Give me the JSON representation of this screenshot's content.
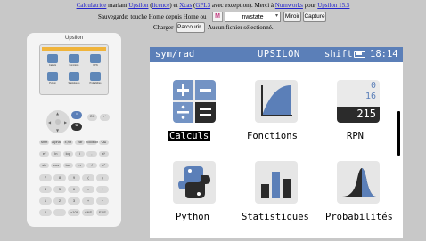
{
  "header": {
    "line1": {
      "calc_link": "Calculatrice",
      "text_a": " mariant ",
      "upsilon_link": "Upsilon",
      "text_b": " (",
      "licence_link": "licence",
      "text_c": ") et ",
      "xcas_link": "Xcas",
      "text_d": " (",
      "gpl_link": "GPL3",
      "text_e": " avec exception). Merci à ",
      "numworks_link": "Numworks",
      "text_f": " pour ",
      "upsilon_ver_link": "Upsilon 15.5"
    },
    "save_label": "Sauvegarde: touche Home depuis Home ou",
    "save_input_value": "nwstate",
    "mirror_button": "Miroir",
    "capture_button": "Capture",
    "load_label": "Charger",
    "browse_button": "Parcourir...",
    "no_file_text": "Aucun fichier sélectionné."
  },
  "calculator": {
    "title": "Upsilon",
    "mini_labels": [
      "Calculs",
      "Fonctions",
      "RPN",
      "Python",
      "Statistiques",
      "Probabilités"
    ],
    "key_rows": [
      [
        "shift",
        "alpha",
        "x,n,t",
        "var",
        "toolbox",
        "⌫"
      ],
      [
        "eˣ",
        "ln",
        "log",
        "i",
        ",",
        "xʸ"
      ],
      [
        "sin",
        "cos",
        "tan",
        "π",
        "√",
        "x²"
      ],
      [
        "7",
        "8",
        "9",
        "(",
        ")"
      ],
      [
        "4",
        "5",
        "6",
        "×",
        "÷"
      ],
      [
        "1",
        "2",
        "3",
        "+",
        "−"
      ],
      [
        "0",
        ".",
        "×10ˣ",
        "ANS",
        "EXE"
      ]
    ]
  },
  "statusbar": {
    "mode": "sym/rad",
    "title": "UPSILON",
    "shift": "shift",
    "time": "18:14"
  },
  "apps": [
    {
      "label": "Calculs",
      "icon": "calculs-icon",
      "selected": true
    },
    {
      "label": "Fonctions",
      "icon": "fonctions-icon",
      "selected": false
    },
    {
      "label": "RPN",
      "icon": "rpn-icon",
      "selected": false
    },
    {
      "label": "Python",
      "icon": "python-icon",
      "selected": false
    },
    {
      "label": "Statistiques",
      "icon": "statistiques-icon",
      "selected": false
    },
    {
      "label": "Probabilités",
      "icon": "probabilites-icon",
      "selected": false
    }
  ],
  "rpn_icon": {
    "top": "0",
    "mid": "16",
    "bottom": "215"
  },
  "colors": {
    "accent": "#5b7fb8",
    "page_bg": "#c8c8c8",
    "link": "#2222cc",
    "battery_bar": "#f0b43c"
  }
}
